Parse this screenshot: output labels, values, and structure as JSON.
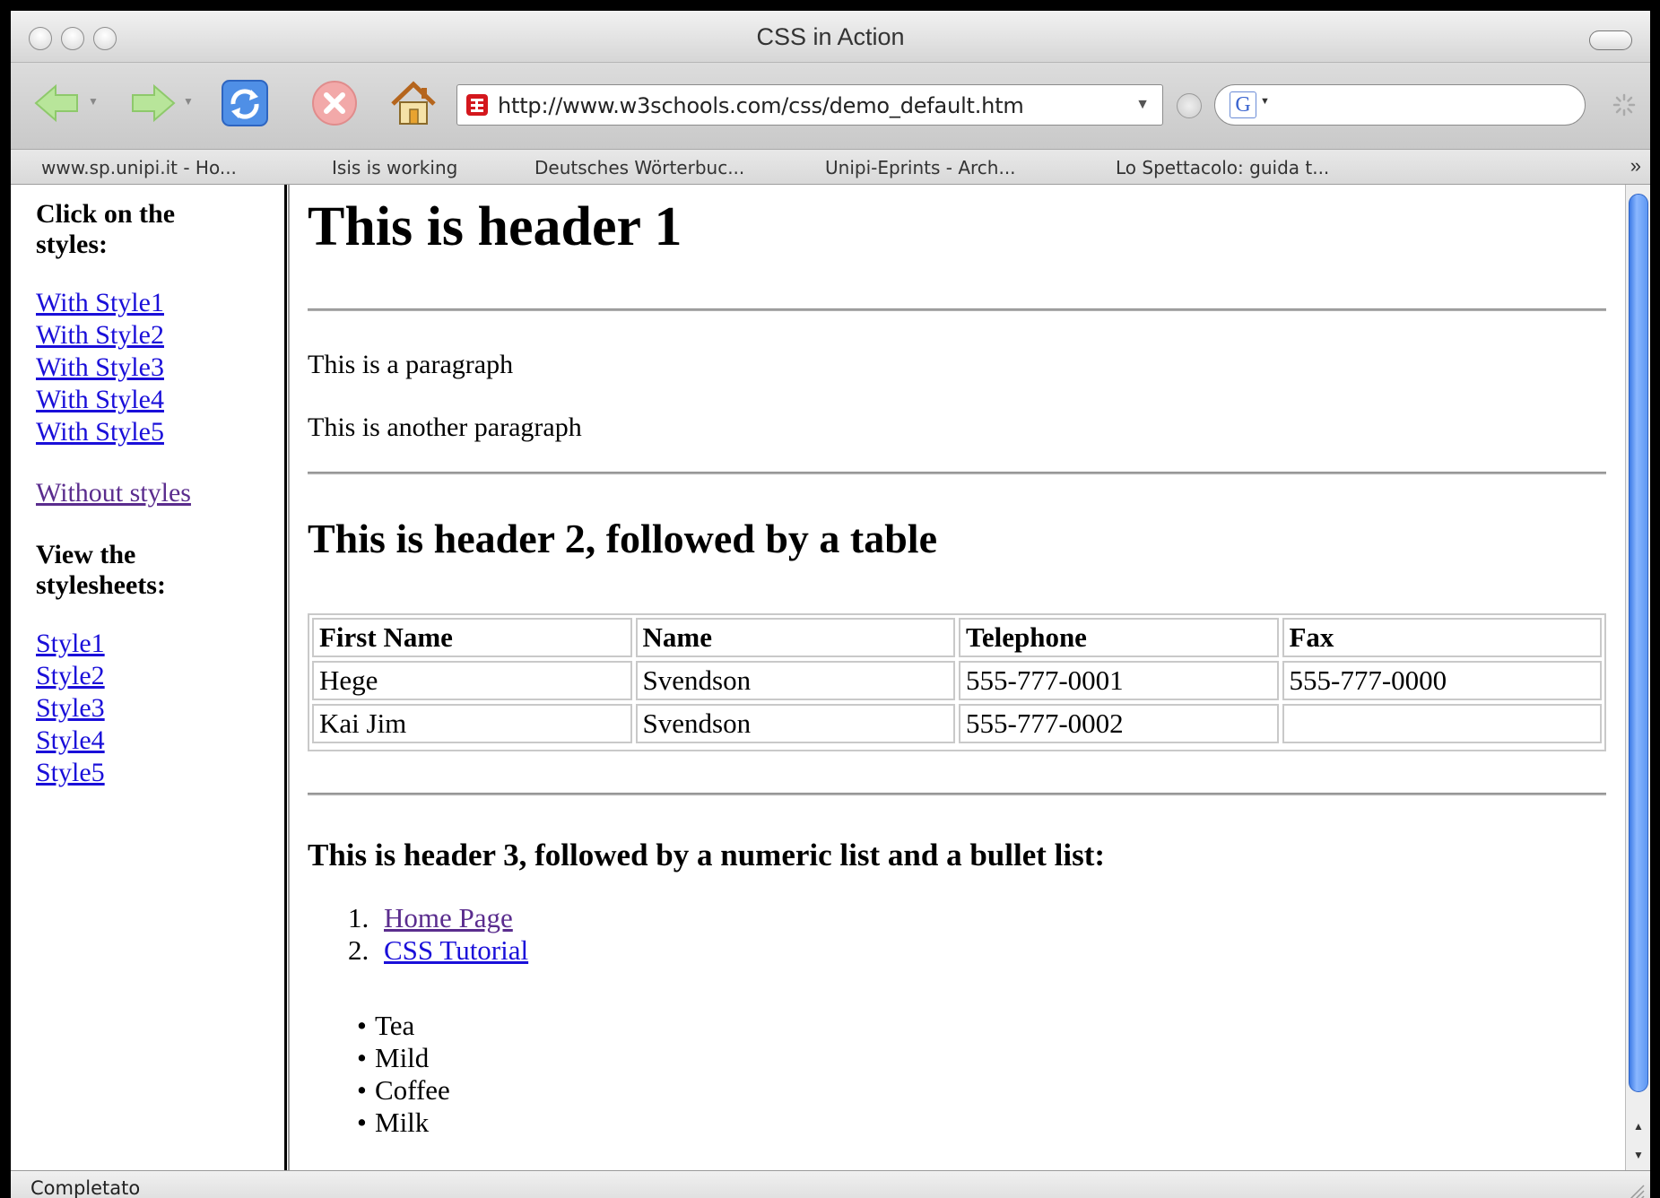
{
  "window": {
    "title": "CSS in Action"
  },
  "toolbar": {
    "url": "http://www.w3schools.com/css/demo_default.htm",
    "search_engine_glyph": "G"
  },
  "bookmarks": [
    "www.sp.unipi.it - Ho...",
    "Isis is working",
    "Deutsches Wörterbuc...",
    "Unipi-Eprints - Arch...",
    "Lo Spettacolo: guida t..."
  ],
  "bookmarks_overflow": "»",
  "sidebar": {
    "styles_heading": "Click on the styles:",
    "style_links": [
      "With Style1",
      "With Style2",
      "With Style3",
      "With Style4",
      "With Style5"
    ],
    "without_styles": "Without styles",
    "sheets_heading": "View the stylesheets:",
    "sheet_links": [
      "Style1",
      "Style2",
      "Style3",
      "Style4",
      "Style5"
    ]
  },
  "main": {
    "h1": "This is header 1",
    "paragraphs": [
      "This is a paragraph",
      "This is another paragraph"
    ],
    "h2": "This is header 2, followed by a table",
    "table": {
      "headers": [
        "First Name",
        "Name",
        "Telephone",
        "Fax"
      ],
      "rows": [
        [
          "Hege",
          "Svendson",
          "555-777-0001",
          "555-777-0000"
        ],
        [
          "Kai Jim",
          "Svendson",
          "555-777-0002",
          ""
        ]
      ]
    },
    "h3": "This is header 3, followed by a numeric list and a bullet list:",
    "ordered_list": [
      {
        "num": "1.",
        "label": "Home Page"
      },
      {
        "num": "2.",
        "label": "CSS Tutorial"
      }
    ],
    "bullet_list": [
      "Tea",
      "Mild",
      "Coffee",
      "Milk"
    ]
  },
  "status": {
    "text": "Completato"
  },
  "colors": {
    "link": "#1a0fd9",
    "visited": "#5b2d8e",
    "scroll_thumb": "#3d7be6"
  },
  "icons": [
    "back-arrow-icon",
    "forward-arrow-icon",
    "reload-icon",
    "stop-icon",
    "home-icon",
    "favicon-icon",
    "go-icon",
    "google-search-icon",
    "spinner-icon",
    "resize-grip-icon"
  ]
}
